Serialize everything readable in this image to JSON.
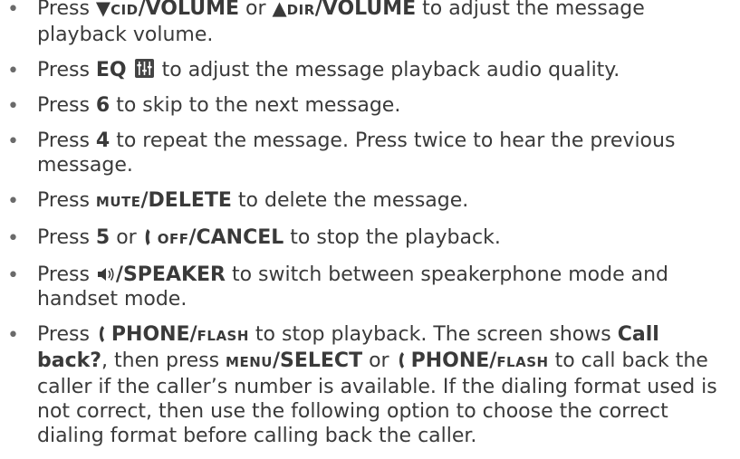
{
  "bullet_glyph": "•",
  "items": [
    {
      "p1": "Press ",
      "tri_down": "▼",
      "k1": "CID",
      "k2": "/VOLUME",
      "p2": " or ",
      "tri_up": "▲",
      "k3": "DIR",
      "k4": "/VOLUME",
      "p3": " to adjust the message playback volume."
    },
    {
      "p1": "Press ",
      "k1": "EQ",
      "p2": " to adjust the message playback audio quality."
    },
    {
      "p1": "Press ",
      "k1": "6",
      "p2": " to skip to the next message."
    },
    {
      "p1": "Press ",
      "k1": "4",
      "p2": " to repeat the message. Press twice to hear the previous message."
    },
    {
      "p1": "Press ",
      "k1": "MUTE",
      "k2": "/DELETE",
      "p2": " to delete the message."
    },
    {
      "p1": "Press ",
      "k1": "5",
      "p2": " or ",
      "k2": "OFF",
      "k3": "/CANCEL",
      "p3": " to stop the playback."
    },
    {
      "p1": "Press ",
      "k1": "/SPEAKER",
      "p2": " to switch between speakerphone mode and handset mode."
    },
    {
      "p1": "Press ",
      "k1": "PHONE",
      "k2": "/",
      "k3": "FLASH",
      "p2": " to stop playback. The screen shows ",
      "k4": "Call back?",
      "p3": ", then press ",
      "k5": "MENU",
      "k6": "/SELECT",
      "p4": " or ",
      "k7": "PHONE",
      "k8": "/",
      "k9": "FLASH",
      "p5": " to call back the caller if the caller’s number is available. If the dialing format used is not correct, then use the following option to choose the correct dialing format before calling back the caller."
    }
  ],
  "icons": {
    "eq": "equalizer-icon",
    "off": "handset-off-icon",
    "speaker": "speaker-icon",
    "phone": "phone-icon"
  }
}
